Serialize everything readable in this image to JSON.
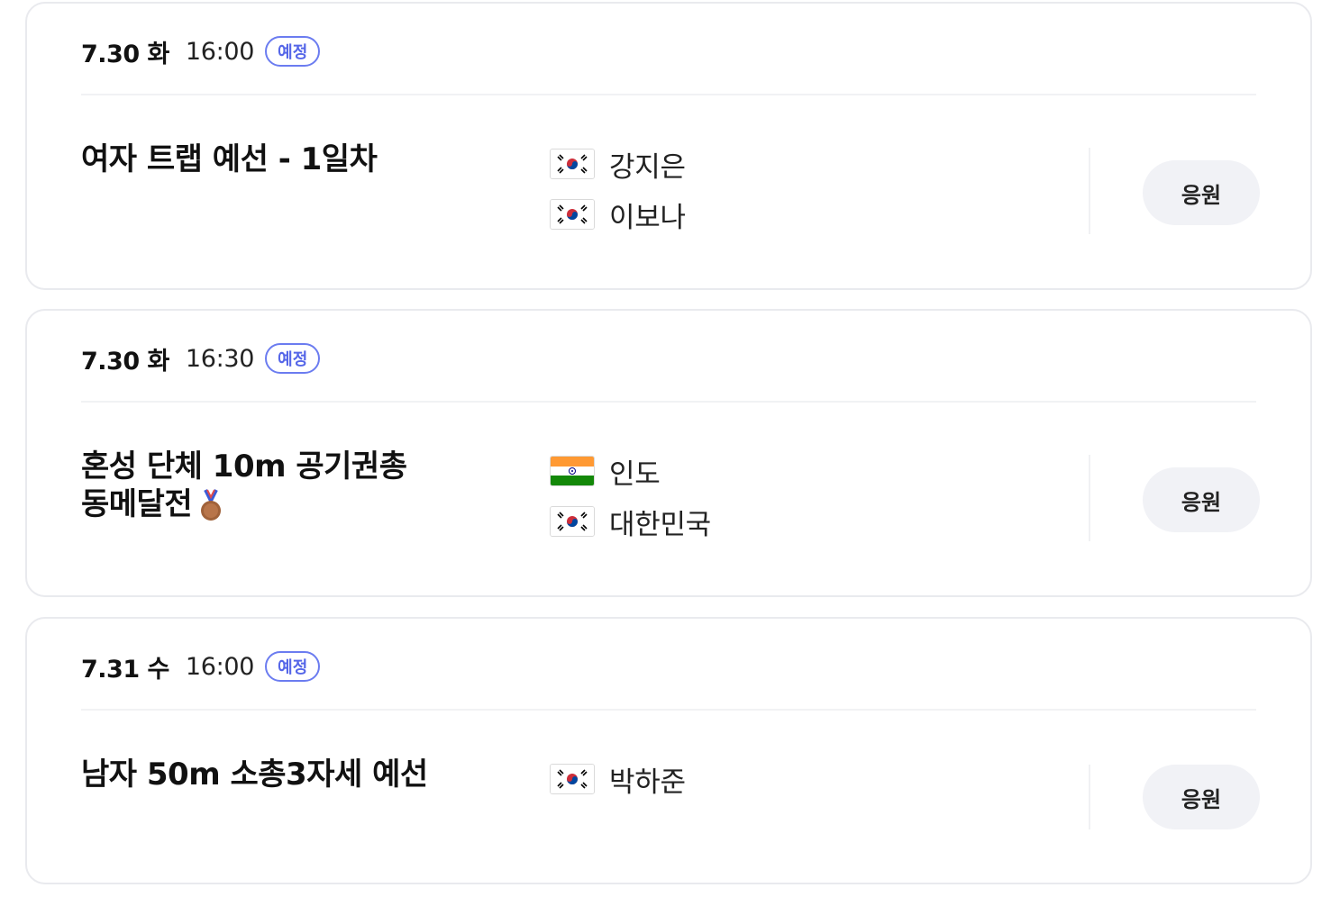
{
  "matches": [
    {
      "date": "7.30 화",
      "time": "16:00",
      "status": "예정",
      "event": "여자 트랩 예선 - 1일차",
      "participants": [
        {
          "name": "강지은",
          "flag": "korea-flag-icon"
        },
        {
          "name": "이보나",
          "flag": "korea-flag-icon"
        }
      ],
      "cheer_label": "응원"
    },
    {
      "date": "7.30 화",
      "time": "16:30",
      "status": "예정",
      "event_line1": "혼성 단체 10m 공기권총",
      "event_line2": "동메달전",
      "event_icon": "bronze-medal-icon",
      "participants": [
        {
          "name": "인도",
          "flag": "india-flag-icon"
        },
        {
          "name": "대한민국",
          "flag": "korea-flag-icon"
        }
      ],
      "cheer_label": "응원"
    },
    {
      "date": "7.31 수",
      "time": "16:00",
      "status": "예정",
      "event": "남자 50m 소총3자세 예선",
      "participants": [
        {
          "name": "박하준",
          "flag": "korea-flag-icon"
        }
      ],
      "cheer_label": "응원"
    }
  ],
  "colors": {
    "badge": "#5566e8",
    "button_bg": "#f1f2f6",
    "card_border": "#e9eaee",
    "bronze": "#a0623a"
  }
}
